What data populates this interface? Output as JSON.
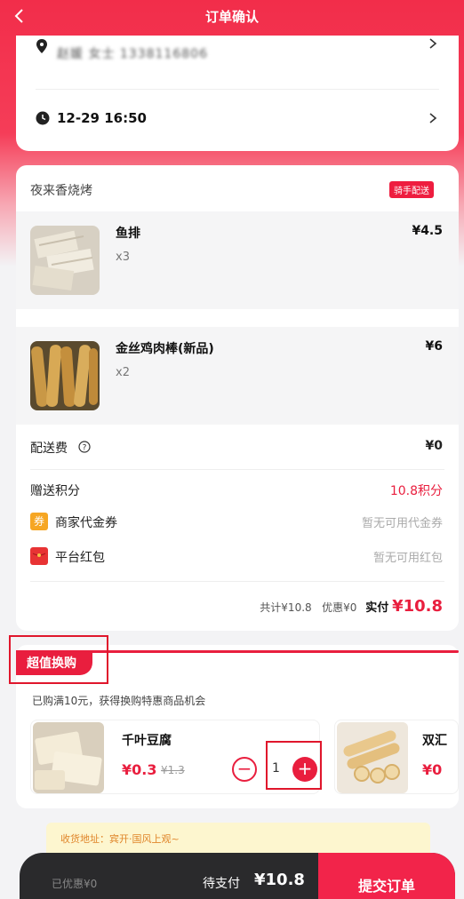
{
  "header": {
    "title": "订单确认"
  },
  "address": {
    "text": "赵媛 女士 1338116806"
  },
  "delivery": {
    "time": "12-29 16:50"
  },
  "store": {
    "name": "夜来香烧烤",
    "badge": "骑手配送"
  },
  "items": [
    {
      "name": "鱼排",
      "qty": "x3",
      "price": "¥4.5"
    },
    {
      "name": "金丝鸡肉棒(新品)",
      "qty": "x2",
      "price": "¥6"
    }
  ],
  "fees": {
    "delivery_label": "配送费",
    "delivery_value": "¥0",
    "points_label": "赠送积分",
    "points_value": "10.8积分",
    "coupon_icon": "券",
    "coupon_label": "商家代金券",
    "coupon_value": "暂无可用代金券",
    "redpacket_label": "平台红包",
    "redpacket_value": "暂无可用红包"
  },
  "summary": {
    "total": "共计¥10.8",
    "discount": "优惠¥0",
    "paid_label": "实付",
    "paid_value": "¥10.8"
  },
  "deal": {
    "tab": "超值换购",
    "subtitle": "已购满10元，获得换购特惠商品机会",
    "products": [
      {
        "name": "千叶豆腐",
        "price": "¥0.3",
        "orig": "¥1.3",
        "qty": "1",
        "minus": "−",
        "plus": "+"
      },
      {
        "name": "双汇",
        "price": "¥0"
      }
    ]
  },
  "tip": {
    "text": "收货地址：宾开·国风上观~"
  },
  "bottom": {
    "saved": "已优惠¥0",
    "pay_label": "待支付",
    "pay_amount": "¥10.8",
    "submit": "提交订单"
  },
  "colors": {
    "accent": "#e91e3e",
    "header": "#f22d4a",
    "bar": "#2a2a2c"
  }
}
